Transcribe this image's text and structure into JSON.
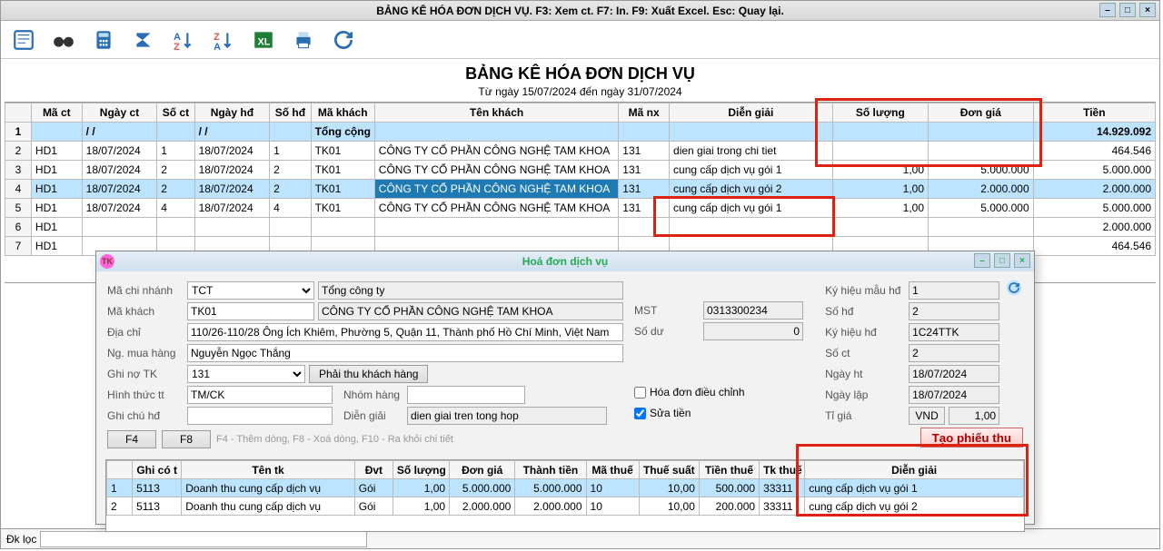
{
  "window": {
    "title": "BẢNG KÊ HÓA ĐƠN DỊCH VỤ. F3: Xem ct. F7: In. F9: Xuất Excel. Esc: Quay lại."
  },
  "report": {
    "title": "BẢNG KÊ HÓA ĐƠN DỊCH VỤ",
    "date_range": "Từ ngày 15/07/2024 đến ngày 31/07/2024"
  },
  "grid": {
    "headers": {
      "ma_ct": "Mã ct",
      "ngay_ct": "Ngày ct",
      "so_ct": "Số ct",
      "ngay_hd": "Ngày hđ",
      "so_hd": "Số hđ",
      "ma_khach": "Mã khách",
      "ten_khach": "Tên khách",
      "ma_nx": "Mã nx",
      "dien_giai": "Diễn giải",
      "so_luong": "Số lượng",
      "don_gia": "Đơn giá",
      "tien": "Tiền"
    },
    "total_row": {
      "label": "Tổng cộng",
      "ngay1": "/  /",
      "ngay2": "/  /",
      "tien": "14.929.092"
    },
    "rows": [
      {
        "n": "2",
        "ma_ct": "HD1",
        "ngay_ct": "18/07/2024",
        "so_ct": "1",
        "ngay_hd": "18/07/2024",
        "so_hd": "1",
        "ma_khach": "TK01",
        "ten_khach": "CÔNG TY CỔ PHẦN CÔNG NGHỆ TAM KHOA",
        "ma_nx": "131",
        "dien_giai": "dien giai trong chi tiet",
        "so_luong": "",
        "don_gia": "",
        "tien": "464.546"
      },
      {
        "n": "3",
        "ma_ct": "HD1",
        "ngay_ct": "18/07/2024",
        "so_ct": "2",
        "ngay_hd": "18/07/2024",
        "so_hd": "2",
        "ma_khach": "TK01",
        "ten_khach": "CÔNG TY CỔ PHẦN CÔNG NGHỆ TAM KHOA",
        "ma_nx": "131",
        "dien_giai": "cung cấp dịch vụ gói 1",
        "so_luong": "1,00",
        "don_gia": "5.000.000",
        "tien": "5.000.000"
      },
      {
        "n": "4",
        "ma_ct": "HD1",
        "ngay_ct": "18/07/2024",
        "so_ct": "2",
        "ngay_hd": "18/07/2024",
        "so_hd": "2",
        "ma_khach": "TK01",
        "ten_khach": "CÔNG TY CỔ PHẦN CÔNG NGHỆ TAM KHOA",
        "ma_nx": "131",
        "dien_giai": "cung cấp dịch vụ gói 2",
        "so_luong": "1,00",
        "don_gia": "2.000.000",
        "tien": "2.000.000"
      },
      {
        "n": "5",
        "ma_ct": "HD1",
        "ngay_ct": "18/07/2024",
        "so_ct": "4",
        "ngay_hd": "18/07/2024",
        "so_hd": "4",
        "ma_khach": "TK01",
        "ten_khach": "CÔNG TY CỔ PHẦN CÔNG NGHỆ TAM KHOA",
        "ma_nx": "131",
        "dien_giai": "cung cấp dịch vụ gói 1",
        "so_luong": "1,00",
        "don_gia": "5.000.000",
        "tien": "5.000.000"
      },
      {
        "n": "6",
        "ma_ct": "HD1",
        "ngay_ct": "",
        "so_ct": "",
        "ngay_hd": "",
        "so_hd": "",
        "ma_khach": "",
        "ten_khach": "",
        "ma_nx": "",
        "dien_giai": "",
        "so_luong": "",
        "don_gia": "",
        "tien": "2.000.000"
      },
      {
        "n": "7",
        "ma_ct": "HD1",
        "ngay_ct": "",
        "so_ct": "",
        "ngay_hd": "",
        "so_hd": "",
        "ma_khach": "",
        "ten_khach": "",
        "ma_nx": "",
        "dien_giai": "",
        "so_luong": "",
        "don_gia": "",
        "tien": "464.546"
      }
    ]
  },
  "footer": {
    "label": "Đk lọc"
  },
  "dialog": {
    "title": "Hoá đơn dịch vụ",
    "labels": {
      "ma_chi_nhanh": "Mã chi nhánh",
      "ma_khach": "Mã khách",
      "dia_chi": "Địa chỉ",
      "ng_mua_hang": "Ng. mua hàng",
      "ghi_no_tk": "Ghi nợ TK",
      "hinh_thuc_tt": "Hình thức tt",
      "ghi_chu_hd": "Ghi chú hđ",
      "mst": "MST",
      "so_du": "Số dư",
      "hoa_don_dc": "Hóa đơn điều chỉnh",
      "sua_tien": "Sửa tiền",
      "ky_hieu_mau_hd": "Ký hiệu mẫu hđ",
      "so_hd": "Số hđ",
      "ky_hieu_hd": "Ký hiệu hđ",
      "so_ct": "Số ct",
      "ngay_ht": "Ngày ht",
      "ngay_lap": "Ngày lập",
      "ti_gia": "Tỉ giá",
      "nhom_hang": "Nhóm hàng",
      "dien_giai": "Diễn giải",
      "f4": "F4",
      "f8": "F8",
      "tao_phieu_thu": "Tạo phiếu thu",
      "hint": "F4 - Thêm dòng, F8 - Xoá dòng, F10 - Ra khỏi chi tiết",
      "phai_thu": "Phải thu khách hàng",
      "tong_cty": "Tổng công ty"
    },
    "values": {
      "ma_chi_nhanh": "TCT",
      "ma_khach": "TK01",
      "ten_khach": "CÔNG TY CỔ PHẦN CÔNG NGHỆ TAM KHOA",
      "dia_chi": "110/26-110/28 Ông Ích Khiêm, Phường 5, Quận 11, Thành phố Hồ Chí Minh, Việt Nam",
      "ng_mua_hang": "Nguyễn Ngọc Thắng",
      "ghi_no_tk": "131",
      "hinh_thuc_tt": "TM/CK",
      "dien_giai": "dien giai tren tong hop",
      "mst": "0313300234",
      "so_du": "0",
      "ky_hieu_mau_hd": "1",
      "so_hd": "2",
      "ky_hieu_hd": "1C24TTK",
      "so_ct": "2",
      "ngay_ht": "18/07/2024",
      "ngay_lap": "18/07/2024",
      "currency": "VND",
      "ti_gia": "1,00"
    },
    "grid": {
      "headers": {
        "ghi_co_t": "Ghi có t",
        "ten_tk": "Tên tk",
        "dvt": "Đvt",
        "so_luong": "Số lượng",
        "don_gia": "Đơn giá",
        "thanh_tien": "Thành tiền",
        "ma_thue": "Mã thuế",
        "thue_suat": "Thuế suất",
        "tien_thue": "Tiền thuế",
        "tk_thue": "Tk thuế",
        "dien_giai": "Diễn giải"
      },
      "rows": [
        {
          "n": "1",
          "ghi_co_t": "5113",
          "ten_tk": "Doanh thu cung cấp dịch vụ",
          "dvt": "Gói",
          "so_luong": "1,00",
          "don_gia": "5.000.000",
          "thanh_tien": "5.000.000",
          "ma_thue": "10",
          "thue_suat": "10,00",
          "tien_thue": "500.000",
          "tk_thue": "33311",
          "dien_giai": "cung cấp dịch vụ gói 1"
        },
        {
          "n": "2",
          "ghi_co_t": "5113",
          "ten_tk": "Doanh thu cung cấp dịch vụ",
          "dvt": "Gói",
          "so_luong": "1,00",
          "don_gia": "2.000.000",
          "thanh_tien": "2.000.000",
          "ma_thue": "10",
          "thue_suat": "10,00",
          "tien_thue": "200.000",
          "tk_thue": "33311",
          "dien_giai": "cung cấp dịch vụ gói 2"
        }
      ]
    }
  }
}
